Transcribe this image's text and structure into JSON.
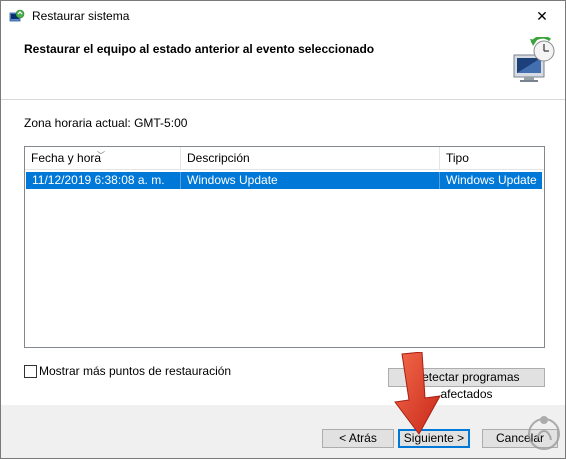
{
  "window": {
    "title": "Restaurar sistema",
    "close_symbol": "✕"
  },
  "header": {
    "heading": "Restaurar el equipo al estado anterior al evento seleccionado",
    "icon": "system-restore-icon"
  },
  "content": {
    "timezone_label": "Zona horaria actual: GMT-5:00",
    "table": {
      "columns": [
        "Fecha y hora",
        "Descripción",
        "Tipo"
      ],
      "sort_indicator": "﹀",
      "rows": [
        {
          "date": "11/12/2019 6:38:08 a. m.",
          "description": "Windows Update",
          "type": "Windows Update",
          "selected": true
        }
      ]
    },
    "show_more_label": "Mostrar más puntos de restauración",
    "show_more_checked": false,
    "detect_button_label": "Detectar programas afectados"
  },
  "footer": {
    "back_label": "< Atrás",
    "next_label": "Siguiente >",
    "cancel_label": "Cancelar"
  },
  "colors": {
    "selection": "#0078d7",
    "annotation_arrow": "#e8402a",
    "footer_bg": "#f0f0f0"
  }
}
